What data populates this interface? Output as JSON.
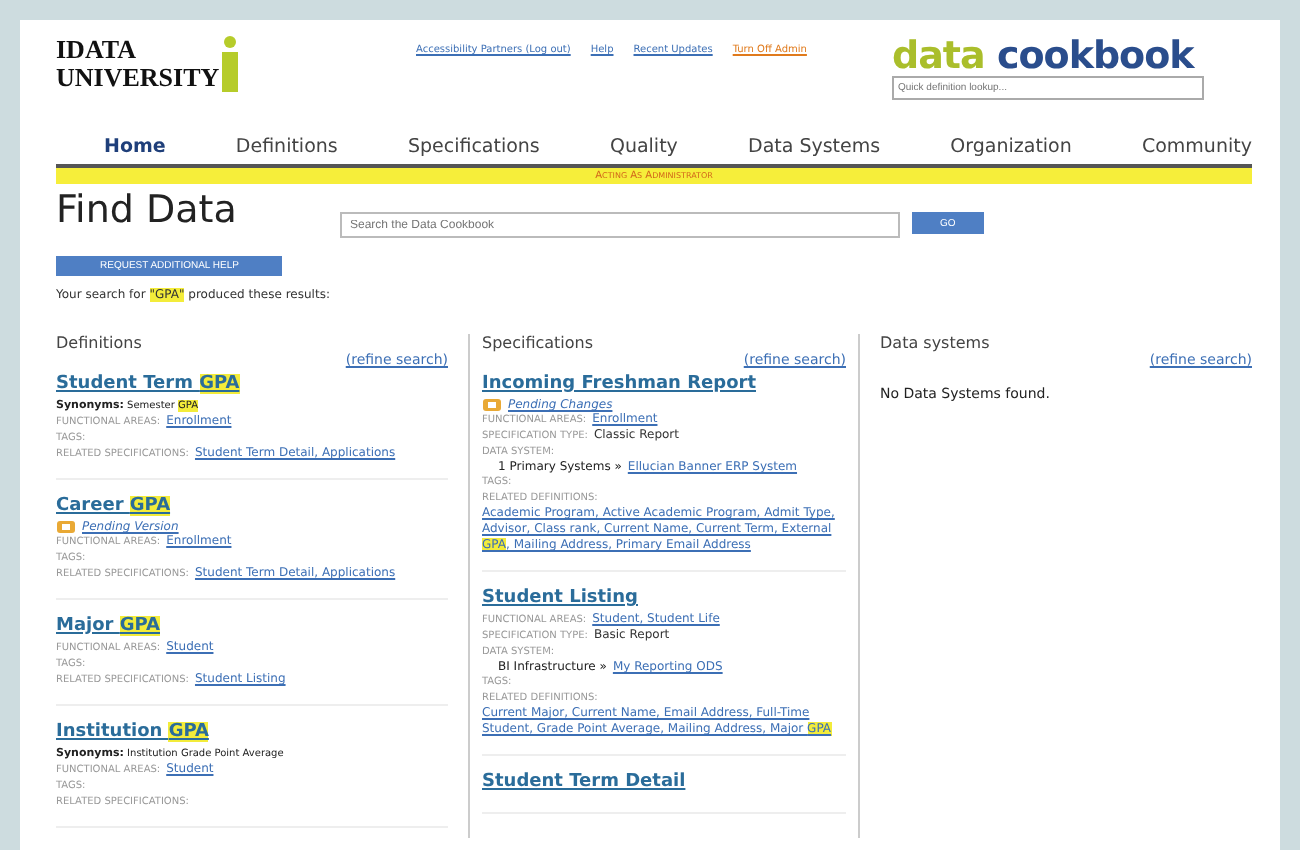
{
  "header": {
    "logo": {
      "line1": "IDATA",
      "line2": "UNIVERSITY"
    },
    "links": [
      {
        "label": "Accessibility Partners (Log out)",
        "kind": "blue"
      },
      {
        "label": "Help",
        "kind": "blue"
      },
      {
        "label": "Recent Updates",
        "kind": "blue"
      },
      {
        "label": "Turn Off Admin",
        "kind": "orange"
      }
    ],
    "brand": {
      "part1": "data",
      "part2": "cookbook"
    },
    "lookup": {
      "placeholder": "Quick definition lookup..."
    }
  },
  "nav": [
    {
      "label": "Home",
      "selected": true
    },
    {
      "label": "Definitions",
      "selected": false
    },
    {
      "label": "Specifications",
      "selected": false
    },
    {
      "label": "Quality",
      "selected": false
    },
    {
      "label": "Data Systems",
      "selected": false
    },
    {
      "label": "Organization",
      "selected": false
    },
    {
      "label": "Community",
      "selected": false
    }
  ],
  "banner": "Acting As Administrator",
  "title": "Find Data",
  "search": {
    "placeholder": "Search the Data Cookbook",
    "button": "GO"
  },
  "help_button": "REQUEST ADDITIONAL HELP",
  "result_line": "Your search for **\"GPA\"** produced these results:",
  "columns": [
    {
      "heading": "Definitions",
      "refine": "(refine search)",
      "entries": [
        {
          "title": "Student Term **GPA**",
          "synonyms": {
            "label": "Synonyms:",
            "value": "Semester **GPA**"
          },
          "fields": [
            {
              "label": "FUNCTIONAL AREAS:",
              "value": "Enrollment",
              "kind": "link"
            },
            {
              "label": "TAGS:",
              "kind": "link"
            },
            {
              "label": "RELATED SPECIFICATIONS:",
              "value": "Student Term Detail, Applications",
              "kind": "link"
            }
          ]
        },
        {
          "title": "Career **GPA**",
          "pending": "Pending Version",
          "fields": [
            {
              "label": "FUNCTIONAL AREAS:",
              "value": "Enrollment",
              "kind": "link"
            },
            {
              "label": "TAGS:",
              "kind": "link"
            },
            {
              "label": "RELATED SPECIFICATIONS:",
              "value": "Student Term Detail, Applications",
              "kind": "link"
            }
          ]
        },
        {
          "title": "Major **GPA**",
          "fields": [
            {
              "label": "FUNCTIONAL AREAS:",
              "value": "Student",
              "kind": "link"
            },
            {
              "label": "TAGS:",
              "kind": "link"
            },
            {
              "label": "RELATED SPECIFICATIONS:",
              "value": "Student Listing",
              "kind": "link"
            }
          ]
        },
        {
          "title": "Institution **GPA**",
          "synonyms": {
            "label": "Synonyms:",
            "value": "Institution Grade Point Average"
          },
          "fields": [
            {
              "label": "FUNCTIONAL AREAS:",
              "value": "Student",
              "kind": "link"
            },
            {
              "label": "TAGS:",
              "kind": "link"
            },
            {
              "label": "RELATED SPECIFICATIONS:",
              "kind": "link"
            }
          ]
        }
      ]
    },
    {
      "heading": "Specifications",
      "refine": "(refine search)",
      "entries": [
        {
          "title": "Incoming Freshman Report",
          "pending": "Pending Changes",
          "fields": [
            {
              "label": "FUNCTIONAL AREAS:",
              "value": "Enrollment",
              "kind": "link"
            },
            {
              "label": "SPECIFICATION TYPE:",
              "value": "Classic Report",
              "kind": "plain"
            },
            {
              "label": "DATA SYSTEM:",
              "kind": "link"
            },
            {
              "kind": "system",
              "prefix": "1 Primary Systems »",
              "value": "Ellucian Banner ERP System"
            },
            {
              "label": "TAGS:",
              "kind": "link"
            },
            {
              "label": "RELATED DEFINITIONS:",
              "value": "Academic Program, Active Academic Program, Admit Type, Advisor, Class rank, Current Name, Current Term, External **GPA**, Mailing Address, Primary Email Address",
              "kind": "list"
            }
          ]
        },
        {
          "title": "Student Listing",
          "fields": [
            {
              "label": "FUNCTIONAL AREAS:",
              "value": "Student, Student Life",
              "kind": "link"
            },
            {
              "label": "SPECIFICATION TYPE:",
              "value": "Basic Report",
              "kind": "plain"
            },
            {
              "label": "DATA SYSTEM:",
              "kind": "link"
            },
            {
              "kind": "system",
              "prefix": "BI Infrastructure »",
              "value": "My Reporting ODS"
            },
            {
              "label": "TAGS:",
              "kind": "link"
            },
            {
              "label": "RELATED DEFINITIONS:",
              "value": "Current Major, Current Name, Email Address, Full-Time Student, Grade Point Average, Mailing Address, Major **GPA**",
              "kind": "list"
            }
          ]
        },
        {
          "title": "Student Term Detail"
        }
      ]
    },
    {
      "heading": "Data systems",
      "refine": "(refine search)",
      "empty": "No Data Systems found."
    }
  ]
}
